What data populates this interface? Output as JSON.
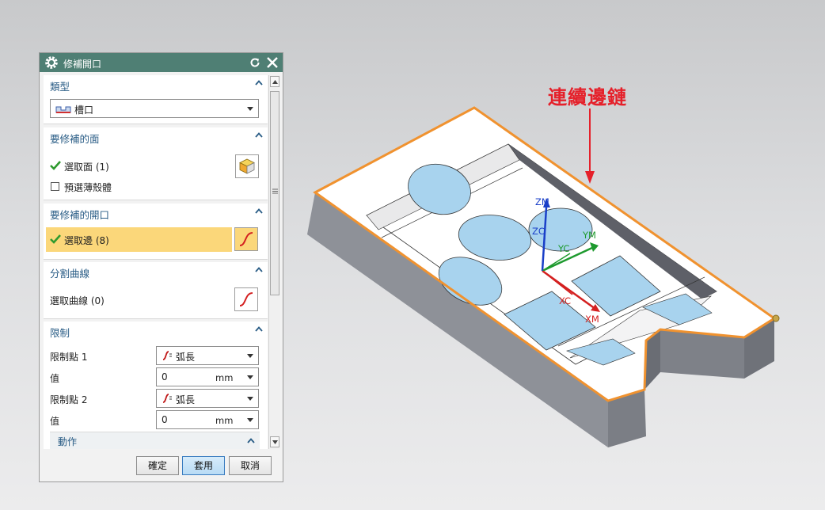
{
  "dialog": {
    "title": "修補開口",
    "groups": {
      "type": {
        "header": "類型",
        "dropdown_value": "槽口"
      },
      "faces": {
        "header": "要修補的面",
        "select_label": "選取面 (1)",
        "checkbox_label": "預選薄殼體"
      },
      "opening": {
        "header": "要修補的開口",
        "select_label": "選取邊 (8)"
      },
      "split": {
        "header": "分割曲線",
        "select_label": "選取曲線 (0)"
      },
      "limits": {
        "header": "限制",
        "point1_label": "限制點 1",
        "point1_value": "弧長",
        "value1_label": "值",
        "value1_number": "0",
        "value1_unit": "mm",
        "point2_label": "限制點 2",
        "point2_value": "弧長",
        "value2_label": "值",
        "value2_number": "0",
        "value2_unit": "mm",
        "action_header": "動作"
      }
    },
    "buttons": {
      "ok": "確定",
      "apply": "套用",
      "cancel": "取消"
    }
  },
  "viewport": {
    "callout": "連續邊鏈",
    "axes": {
      "zm": "ZM",
      "zc": "ZC",
      "yc": "YC",
      "ym": "YM",
      "xc": "XC",
      "xm": "XM"
    }
  },
  "colors": {
    "titlebar": "#4f7f74",
    "header_text": "#2a5d86",
    "highlight_row": "#fbd77a",
    "edge_highlight": "#f0922f",
    "callout": "#e5202a"
  }
}
